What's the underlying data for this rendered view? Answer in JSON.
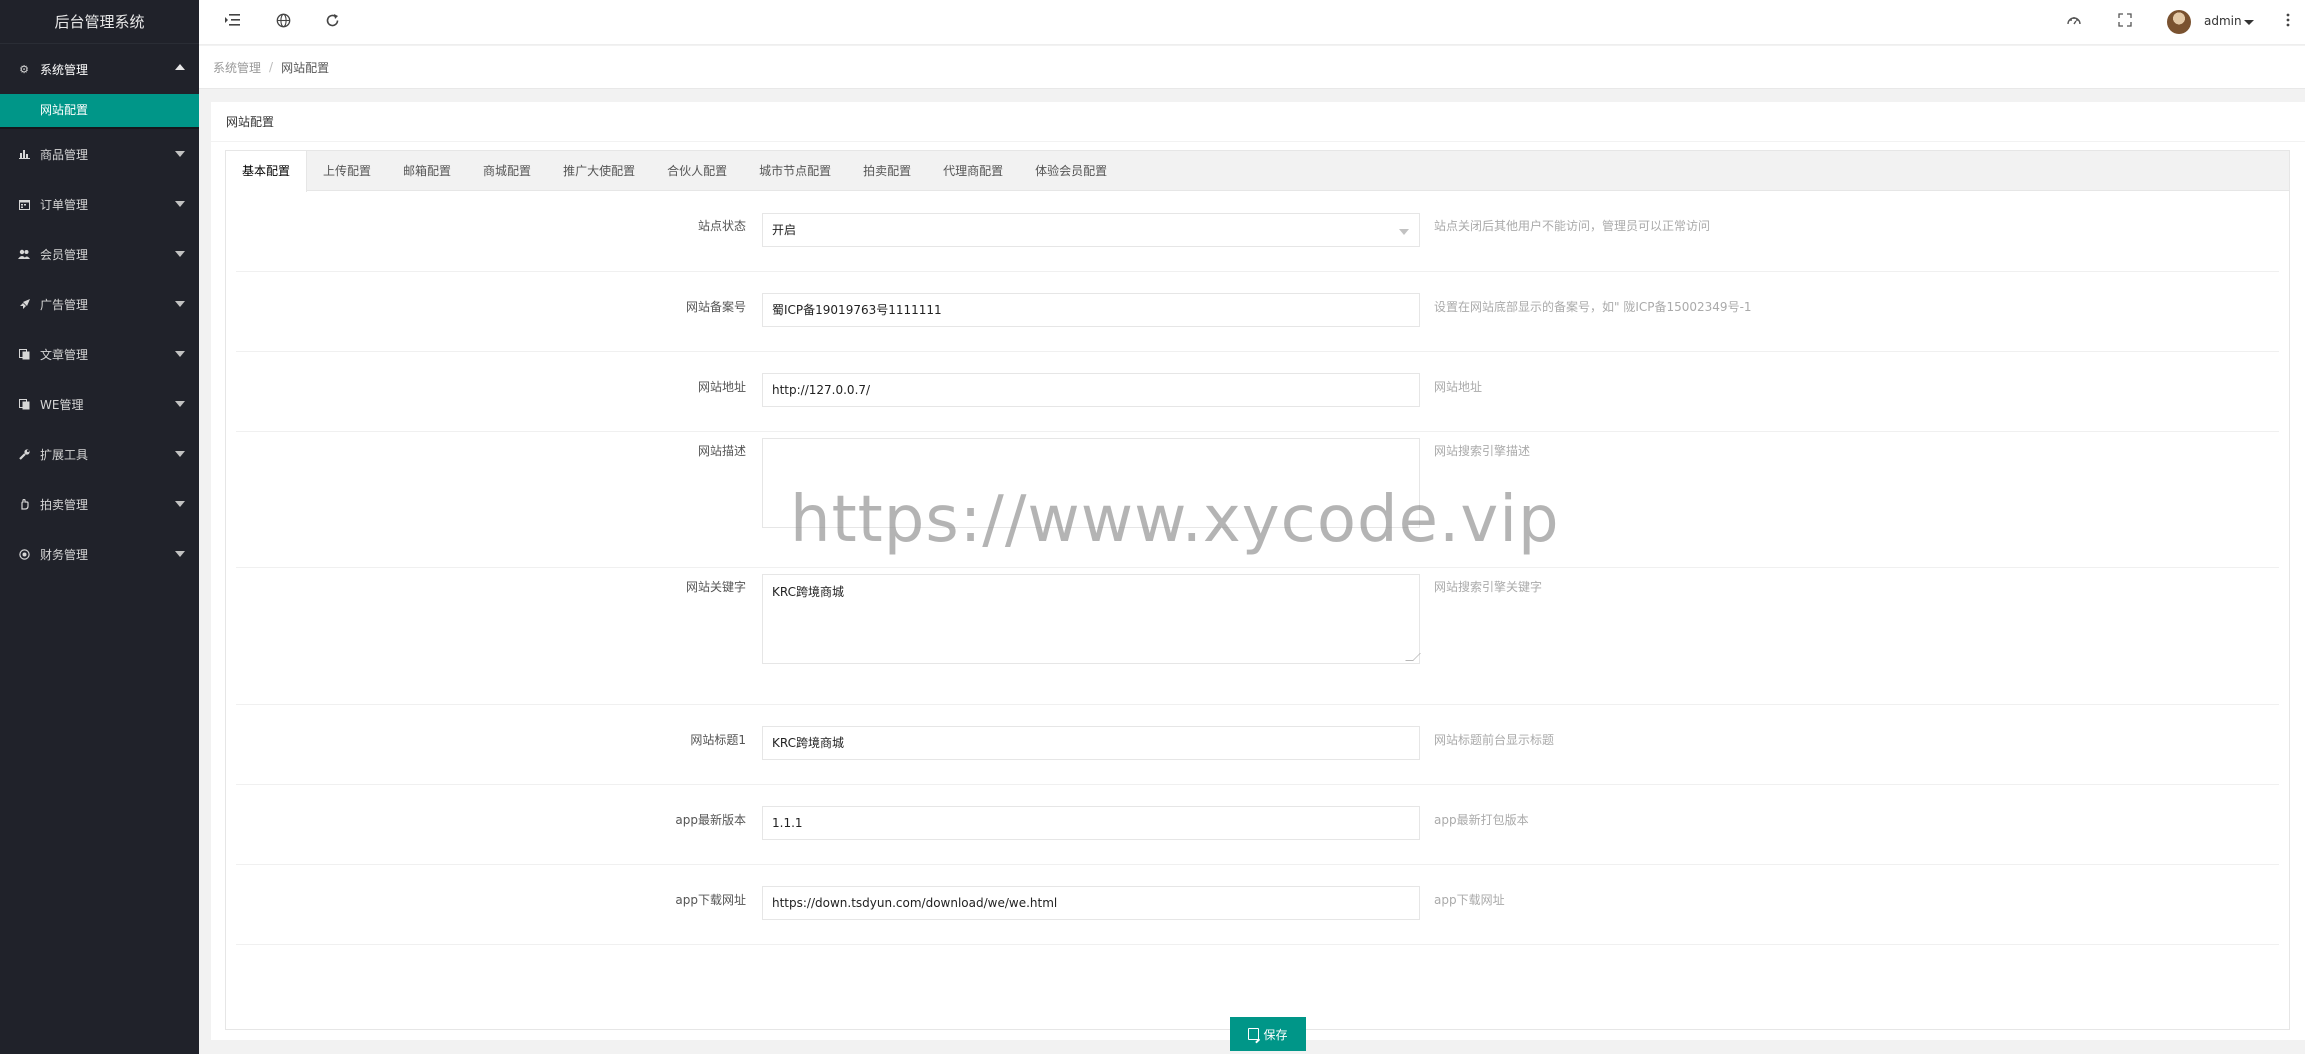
{
  "sidebar": {
    "title": "后台管理系统",
    "items": [
      {
        "label": "系统管理",
        "icon": "gear-icon"
      },
      {
        "label": "商品管理",
        "icon": "chart-icon"
      },
      {
        "label": "订单管理",
        "icon": "calendar-icon"
      },
      {
        "label": "会员管理",
        "icon": "users-icon"
      },
      {
        "label": "广告管理",
        "icon": "rocket-icon"
      },
      {
        "label": "文章管理",
        "icon": "copy-icon"
      },
      {
        "label": "WE管理",
        "icon": "copy-icon"
      },
      {
        "label": "扩展工具",
        "icon": "wrench-icon"
      },
      {
        "label": "拍卖管理",
        "icon": "hand-icon"
      },
      {
        "label": "财务管理",
        "icon": "circle-icon"
      }
    ],
    "sub_active": "网站配置"
  },
  "header": {
    "user": "admin"
  },
  "breadcrumb": {
    "parent": "系统管理",
    "separator": "/",
    "current": "网站配置"
  },
  "card": {
    "title": "网站配置"
  },
  "tabs": [
    "基本配置",
    "上传配置",
    "邮箱配置",
    "商城配置",
    "推广大使配置",
    "合伙人配置",
    "城市节点配置",
    "拍卖配置",
    "代理商配置",
    "体验会员配置"
  ],
  "form": {
    "site_status": {
      "label": "站点状态",
      "value": "开启",
      "tip": "站点关闭后其他用户不能访问，管理员可以正常访问"
    },
    "icp": {
      "label": "网站备案号",
      "value": "蜀ICP备19019763号1111111",
      "tip": "设置在网站底部显示的备案号，如\" 陇ICP备15002349号-1"
    },
    "url": {
      "label": "网站地址",
      "value": "http://127.0.0.7/",
      "tip": "网站地址"
    },
    "desc": {
      "label": "网站描述",
      "value": "",
      "tip": "网站搜索引擎描述"
    },
    "keywords": {
      "label": "网站关键字",
      "value": "KRC跨境商城",
      "tip": "网站搜索引擎关键字"
    },
    "title1": {
      "label": "网站标题1",
      "value": "KRC跨境商城",
      "tip": "网站标题前台显示标题"
    },
    "app_version": {
      "label": "app最新版本",
      "value": "1.1.1",
      "tip": "app最新打包版本"
    },
    "app_url": {
      "label": "app下载网址",
      "value": "https://down.tsdyun.com/download/we/we.html",
      "tip": "app下载网址"
    }
  },
  "save_label": "保存",
  "watermark": "https://www.xycode.vip"
}
